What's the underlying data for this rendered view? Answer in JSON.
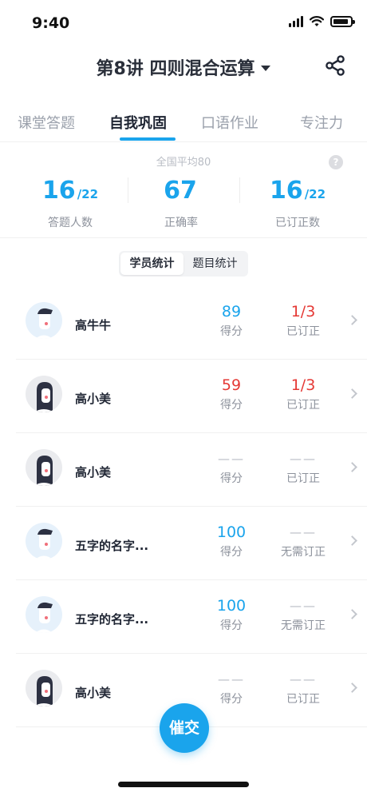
{
  "status_bar": {
    "time": "9:40",
    "battery_level": 0.9
  },
  "header": {
    "title": "第8讲 四则混合运算",
    "share_icon": "share-icon"
  },
  "tabs": [
    {
      "label": "课堂答题",
      "active": false
    },
    {
      "label": "自我巩固",
      "active": true
    },
    {
      "label": "口语作业",
      "active": false
    },
    {
      "label": "专注力",
      "active": false
    }
  ],
  "summary": {
    "national_average": "全国平均80",
    "stats": [
      {
        "value": "16",
        "total": "/22",
        "label": "答题人数"
      },
      {
        "value": "67",
        "total": "",
        "label": "正确率"
      },
      {
        "value": "16",
        "total": "/22",
        "label": "已订正数"
      }
    ]
  },
  "segment": {
    "options": [
      "学员统计",
      "题目统计"
    ],
    "selected": "学员统计"
  },
  "students": [
    {
      "name": "高牛牛",
      "score": "89",
      "score_label": "得分",
      "score_color": "#1aa4ec",
      "fix": "1/3",
      "fix_label": "已订正",
      "fix_color": "#e53935",
      "avatar": "boy"
    },
    {
      "name": "高小美",
      "score": "59",
      "score_label": "得分",
      "score_color": "#e53935",
      "fix": "1/3",
      "fix_label": "已订正",
      "fix_color": "#e53935",
      "avatar": "girl"
    },
    {
      "name": "高小美",
      "score": "——",
      "score_label": "得分",
      "score_color": "#b5b9c1",
      "fix": "——",
      "fix_label": "已订正",
      "fix_color": "#b5b9c1",
      "avatar": "girl"
    },
    {
      "name": "五字的名字...",
      "score": "100",
      "score_label": "得分",
      "score_color": "#1aa4ec",
      "fix": "——",
      "fix_label": "无需订正",
      "fix_color": "#b5b9c1",
      "avatar": "boy"
    },
    {
      "name": "五字的名字...",
      "score": "100",
      "score_label": "得分",
      "score_color": "#1aa4ec",
      "fix": "——",
      "fix_label": "无需订正",
      "fix_color": "#b5b9c1",
      "avatar": "boy"
    },
    {
      "name": "高小美",
      "score": "——",
      "score_label": "得分",
      "score_color": "#b5b9c1",
      "fix": "——",
      "fix_label": "已订正",
      "fix_color": "#b5b9c1",
      "avatar": "girl"
    }
  ],
  "actions": {
    "urge_label": "催交"
  },
  "colors": {
    "accent": "#1aa4ec",
    "error": "#e53935",
    "muted": "#8d929c"
  }
}
